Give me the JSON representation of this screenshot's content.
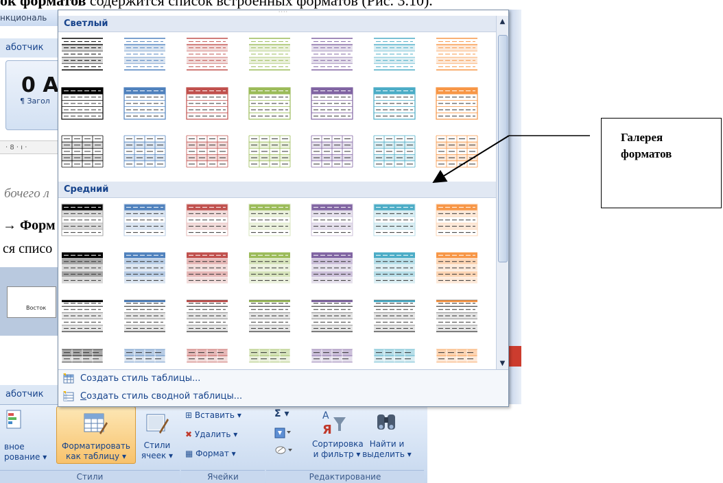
{
  "caption": {
    "bold_part": "ок форматов",
    "rest": " содержится список встроенных форматов (Рис. 3.10)."
  },
  "background": {
    "ribbon_title_fragment": "нкциональ",
    "ribbon_tab_fragment": "аботчик",
    "style_preview_big": "0 А",
    "style_preview_small": "¶ Загол",
    "ruler_fragment": "· 8 · ı ·",
    "doc_line1": "бочего л",
    "doc_line2": "→ Форм",
    "doc_line3": "ся списо",
    "thumbnail_label": "Восток",
    "ribbon_tab2_fragment": "аботчик"
  },
  "ribbon": {
    "conditional_format_line1": "вное",
    "conditional_format_line2": "рование ▾",
    "format_as_table_line1": "Форматировать",
    "format_as_table_line2": "как таблицу ▾",
    "cell_styles_line1": "Стили",
    "cell_styles_line2": "ячеек ▾",
    "insert_label": "Вставить ▾",
    "delete_label": "Удалить ▾",
    "format_label": "Формат ▾",
    "sigma_label": "Σ ▾",
    "sort_filter_line1": "Сортировка",
    "sort_filter_line2": "и фильтр ▾",
    "find_select_line1": "Найти и",
    "find_select_line2": "выделить ▾",
    "group_styles": "Стили",
    "group_cells": "Ячейки",
    "group_editing": "Редактирование"
  },
  "gallery": {
    "section_light": "Светлый",
    "section_medium": "Средний",
    "grip": "····",
    "scroll_up": "▲",
    "scroll_down": "▼",
    "accent_colors": [
      "#000000",
      "#4f81bd",
      "#c0504d",
      "#9bbb59",
      "#8064a2",
      "#4bacc6",
      "#f79646"
    ],
    "light_colors": [
      "#d9d9d9",
      "#dbe5f1",
      "#f2dcdb",
      "#ebf1dd",
      "#e5e0ec",
      "#dbeef3",
      "#fde9d9"
    ],
    "mid_colors": [
      "#a6a6a6",
      "#b8cce4",
      "#e6b8b7",
      "#d7e4bc",
      "#ccc0da",
      "#b7dee8",
      "#fcd5b4"
    ],
    "style_rows": [
      "light-lines",
      "light-header",
      "light-grid",
      "medium-banded",
      "medium-header",
      "medium-accent",
      "medium-partial"
    ]
  },
  "menu": {
    "new_table_style_prefix": "Соз",
    "new_table_style_underline": "д",
    "new_table_style_rest": "ать стиль таблицы...",
    "new_pivot_style_underline": "С",
    "new_pivot_style_rest": "оздать стиль сводной таблицы..."
  },
  "callout": {
    "line1": "Галерея",
    "line2": "форматов"
  }
}
